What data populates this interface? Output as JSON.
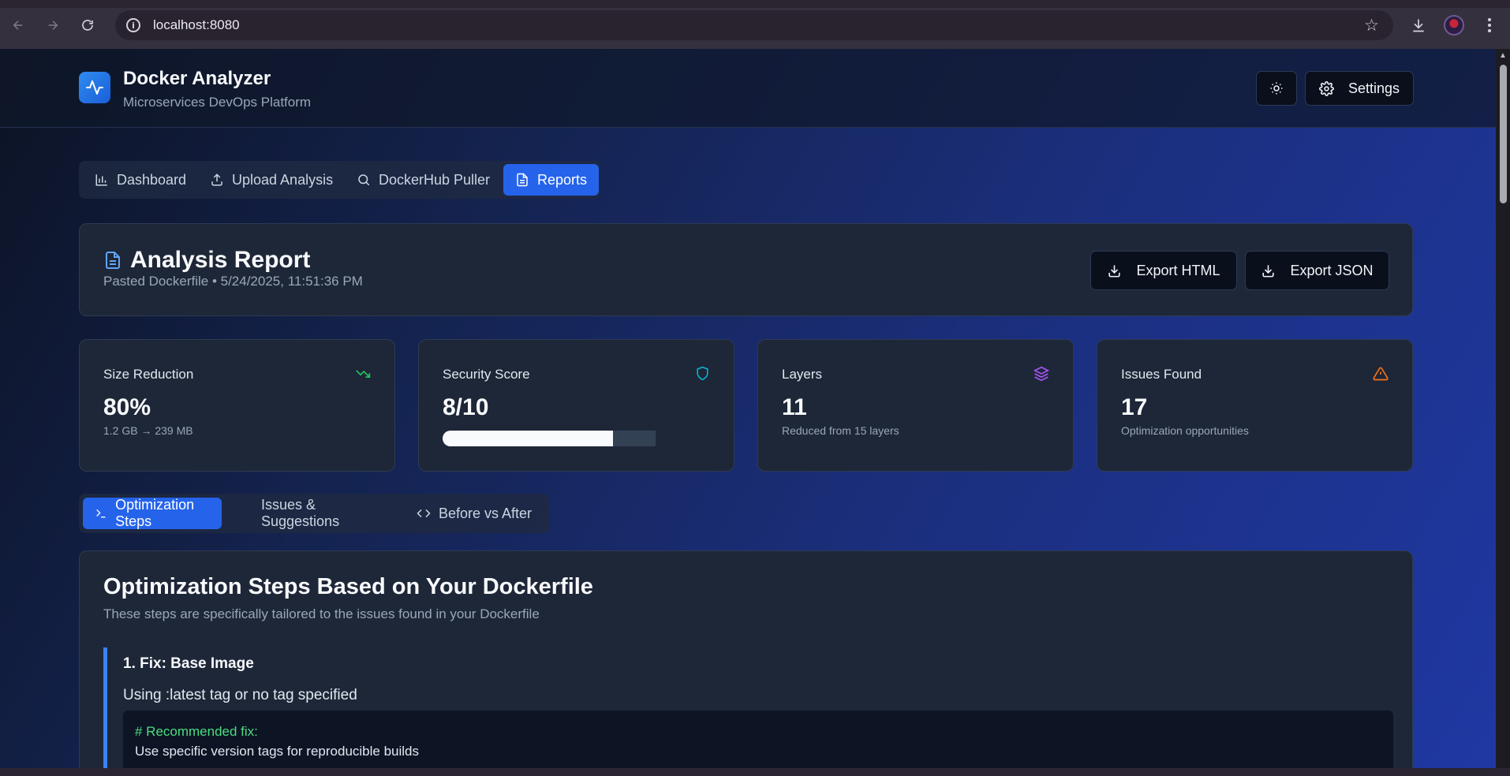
{
  "browser": {
    "url": "localhost:8080"
  },
  "header": {
    "title": "Docker Analyzer",
    "subtitle": "Microservices DevOps Platform",
    "settings_label": "Settings"
  },
  "nav": {
    "tabs": [
      {
        "label": "Dashboard",
        "icon": "bar-chart-icon",
        "active": false
      },
      {
        "label": "Upload Analysis",
        "icon": "upload-icon",
        "active": false
      },
      {
        "label": "DockerHub Puller",
        "icon": "search-icon",
        "active": false
      },
      {
        "label": "Reports",
        "icon": "file-text-icon",
        "active": true
      }
    ]
  },
  "report": {
    "title": "Analysis Report",
    "subtitle": "Pasted Dockerfile • 5/24/2025, 11:51:36 PM",
    "export_html_label": "Export HTML",
    "export_json_label": "Export JSON"
  },
  "stats": [
    {
      "label": "Size Reduction",
      "value": "80%",
      "detail": "1.2 GB → 239 MB",
      "icon": "trending-down-icon",
      "color": "#22c55e"
    },
    {
      "label": "Security Score",
      "value": "8/10",
      "progress": 0.8,
      "icon": "shield-icon",
      "color": "#06b6d4"
    },
    {
      "label": "Layers",
      "value": "11",
      "detail": "Reduced from 15 layers",
      "icon": "layers-icon",
      "color": "#a855f7"
    },
    {
      "label": "Issues Found",
      "value": "17",
      "detail": "Optimization opportunities",
      "icon": "alert-triangle-icon",
      "color": "#f97316"
    }
  ],
  "subtabs": [
    {
      "label": "Optimization Steps",
      "icon": "terminal-icon",
      "active": true
    },
    {
      "label": "Issues & Suggestions",
      "active": false
    },
    {
      "label": "Before vs After",
      "icon": "code-icon",
      "active": false
    }
  ],
  "optimization": {
    "title": "Optimization Steps Based on Your Dockerfile",
    "subtitle": "These steps are specifically tailored to the issues found in your Dockerfile",
    "steps": [
      {
        "title": "1. Fix: Base Image",
        "description": "Using :latest tag or no tag specified",
        "code_comment": "# Recommended fix:",
        "code_line": "Use specific version tags for reproducible builds"
      }
    ]
  },
  "colors": {
    "accent": "#2563eb",
    "step_border": "#3b82f6",
    "code_comment": "#4ade80"
  }
}
